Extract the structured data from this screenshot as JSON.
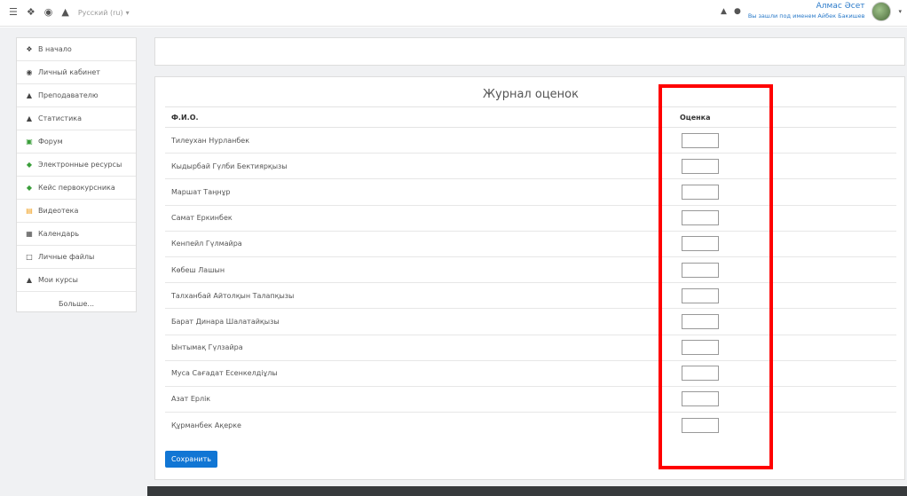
{
  "navbar": {
    "language": "Русский (ru)",
    "user_name": "Алмас Әсет",
    "user_sub": "Вы зашли под именем Айбек Бакишев"
  },
  "sidebar": {
    "items": [
      {
        "label": "В начало",
        "icon": "home-icon"
      },
      {
        "label": "Личный кабинет",
        "icon": "dashboard-icon"
      },
      {
        "label": "Преподавателю",
        "icon": "graduation-cap-icon"
      },
      {
        "label": "Статистика",
        "icon": "graduation-cap-icon"
      },
      {
        "label": "Форум",
        "icon": "forum-icon"
      },
      {
        "label": "Электронные ресурсы",
        "icon": "resource-icon"
      },
      {
        "label": "Кейс первокурсника",
        "icon": "resource-icon"
      },
      {
        "label": "Видеотека",
        "icon": "video-icon"
      },
      {
        "label": "Календарь",
        "icon": "calendar-icon"
      },
      {
        "label": "Личные файлы",
        "icon": "file-icon"
      },
      {
        "label": "Мои курсы",
        "icon": "graduation-cap-icon"
      },
      {
        "label": "Больше...",
        "icon": ""
      }
    ]
  },
  "gradebook": {
    "title": "Журнал оценок",
    "col_name": "Ф.И.О.",
    "col_grade": "Оценка",
    "students": [
      {
        "name": "Тилеухан Нурланбек",
        "grade": ""
      },
      {
        "name": "Кыдырбай Гүлби Бектиярқызы",
        "grade": ""
      },
      {
        "name": "Маршат Таңнұр",
        "grade": ""
      },
      {
        "name": "Самат Еркинбек",
        "grade": ""
      },
      {
        "name": "Кенпейл Гүлмайра",
        "grade": ""
      },
      {
        "name": "Көбеш Лашын",
        "grade": ""
      },
      {
        "name": "Талханбай Айтолқын Талапқызы",
        "grade": ""
      },
      {
        "name": "Барат Динара Шалатайқызы",
        "grade": ""
      },
      {
        "name": "Ынтымақ Гүлзайра",
        "grade": ""
      },
      {
        "name": "Муса Сағадат Есенкелдіұлы",
        "grade": ""
      },
      {
        "name": "Азат Ерлік",
        "grade": ""
      },
      {
        "name": "Құрманбек Ақерке",
        "grade": ""
      }
    ],
    "save_label": "Сохранить"
  },
  "colors": {
    "accent": "#1176d4",
    "highlight": "#ff0000",
    "link": "#2a7ac9"
  }
}
